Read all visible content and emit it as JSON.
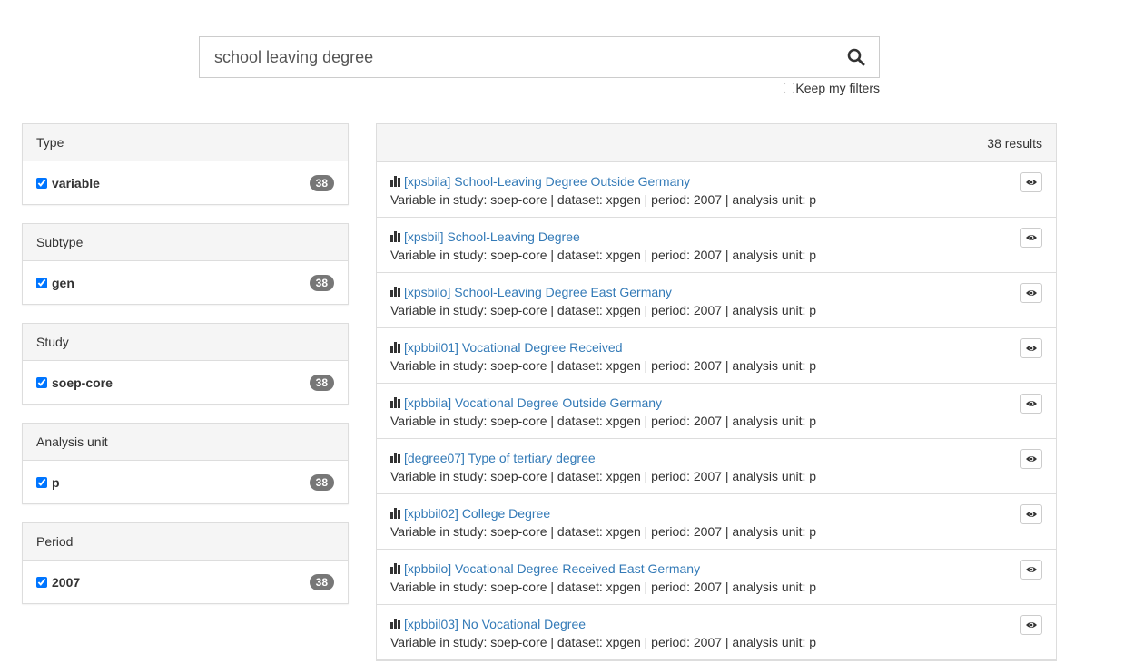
{
  "search": {
    "value": "school leaving degree",
    "button_icon": "search-icon",
    "keep_filters_label": "Keep my filters"
  },
  "facets": [
    {
      "title": "Type",
      "item": "variable",
      "count": "38",
      "checked": true
    },
    {
      "title": "Subtype",
      "item": "gen",
      "count": "38",
      "checked": true
    },
    {
      "title": "Study",
      "item": "soep-core",
      "count": "38",
      "checked": true
    },
    {
      "title": "Analysis unit",
      "item": "p",
      "count": "38",
      "checked": true
    },
    {
      "title": "Period",
      "item": "2007",
      "count": "38",
      "checked": true
    }
  ],
  "results": {
    "count_label": "38 results",
    "items": [
      {
        "title": "[xpsbila] School-Leaving Degree Outside Germany",
        "desc": "Variable in study: soep-core | dataset: xpgen | period: 2007 | analysis unit: p"
      },
      {
        "title": "[xpsbil] School-Leaving Degree",
        "desc": "Variable in study: soep-core | dataset: xpgen | period: 2007 | analysis unit: p"
      },
      {
        "title": "[xpsbilo] School-Leaving Degree East Germany",
        "desc": "Variable in study: soep-core | dataset: xpgen | period: 2007 | analysis unit: p"
      },
      {
        "title": "[xpbbil01] Vocational Degree Received",
        "desc": "Variable in study: soep-core | dataset: xpgen | period: 2007 | analysis unit: p"
      },
      {
        "title": "[xpbbila] Vocational Degree Outside Germany",
        "desc": "Variable in study: soep-core | dataset: xpgen | period: 2007 | analysis unit: p"
      },
      {
        "title": "[degree07] Type of tertiary degree",
        "desc": "Variable in study: soep-core | dataset: xpgen | period: 2007 | analysis unit: p"
      },
      {
        "title": "[xpbbil02] College Degree",
        "desc": "Variable in study: soep-core | dataset: xpgen | period: 2007 | analysis unit: p"
      },
      {
        "title": "[xpbbilo] Vocational Degree Received East Germany",
        "desc": "Variable in study: soep-core | dataset: xpgen | period: 2007 | analysis unit: p"
      },
      {
        "title": "[xpbbil03] No Vocational Degree",
        "desc": "Variable in study: soep-core | dataset: xpgen | period: 2007 | analysis unit: p"
      }
    ]
  },
  "colors": {
    "link": "#337ab7",
    "badge": "#777777",
    "panel_head": "#f5f5f5",
    "border": "#dddddd"
  }
}
